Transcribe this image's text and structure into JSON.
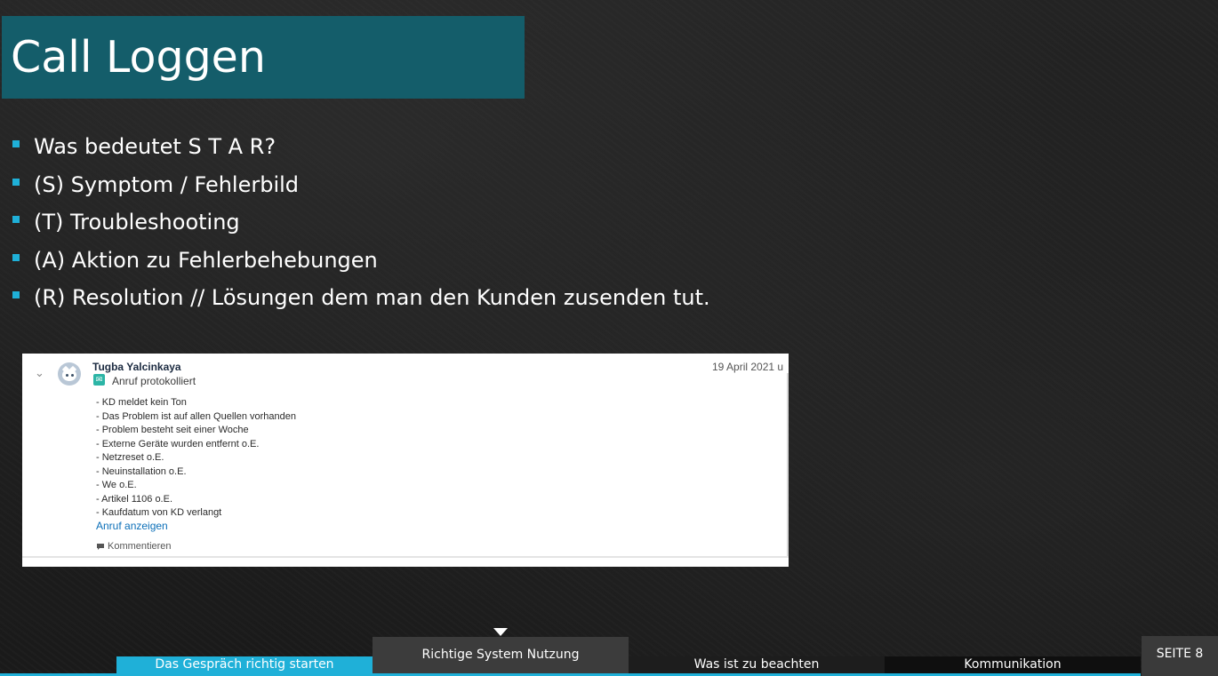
{
  "slide": {
    "title": "Call Loggen",
    "bullets": [
      "Was bedeutet S T A R?",
      "(S) Symptom / Fehlerbild",
      "(T) Troubleshooting",
      "(A) Aktion zu Fehlerbehebungen",
      "(R) Resolution // Lösungen dem man den Kunden zusenden tut."
    ]
  },
  "screenshot": {
    "author": "Tugba Yalcinkaya",
    "status": "Anruf protokolliert",
    "timestamp": "19 April 2021 u",
    "notes": [
      "- KD meldet kein Ton",
      "- Das Problem ist auf allen Quellen vorhanden",
      "- Problem besteht seit einer Woche",
      "- Externe Geräte wurden entfernt o.E.",
      "- Netzreset o.E.",
      "- Neuinstallation o.E.",
      "- We o.E.",
      "- Artikel 1106 o.E.",
      "- Kaufdatum von KD verlangt"
    ],
    "view_call_link": "Anruf anzeigen",
    "comment_label": "Kommentieren",
    "icons": {
      "expand": "chevron-down-icon",
      "avatar": "avatar-icon",
      "call_log": "call-log-icon",
      "comment": "comment-icon"
    }
  },
  "nav": {
    "tabs": [
      "Das Gespräch richtig starten",
      "Richtige System Nutzung",
      "Was ist zu beachten",
      "Kommunikation"
    ],
    "active_tab": "Richtige System Nutzung",
    "page_label": "SEITE 8"
  },
  "colors": {
    "title_bar": "#145d6a",
    "accent": "#1fb0d8",
    "background": "#1c1c1c",
    "active_tab": "#3c3c3c",
    "link": "#0b6fb8"
  }
}
